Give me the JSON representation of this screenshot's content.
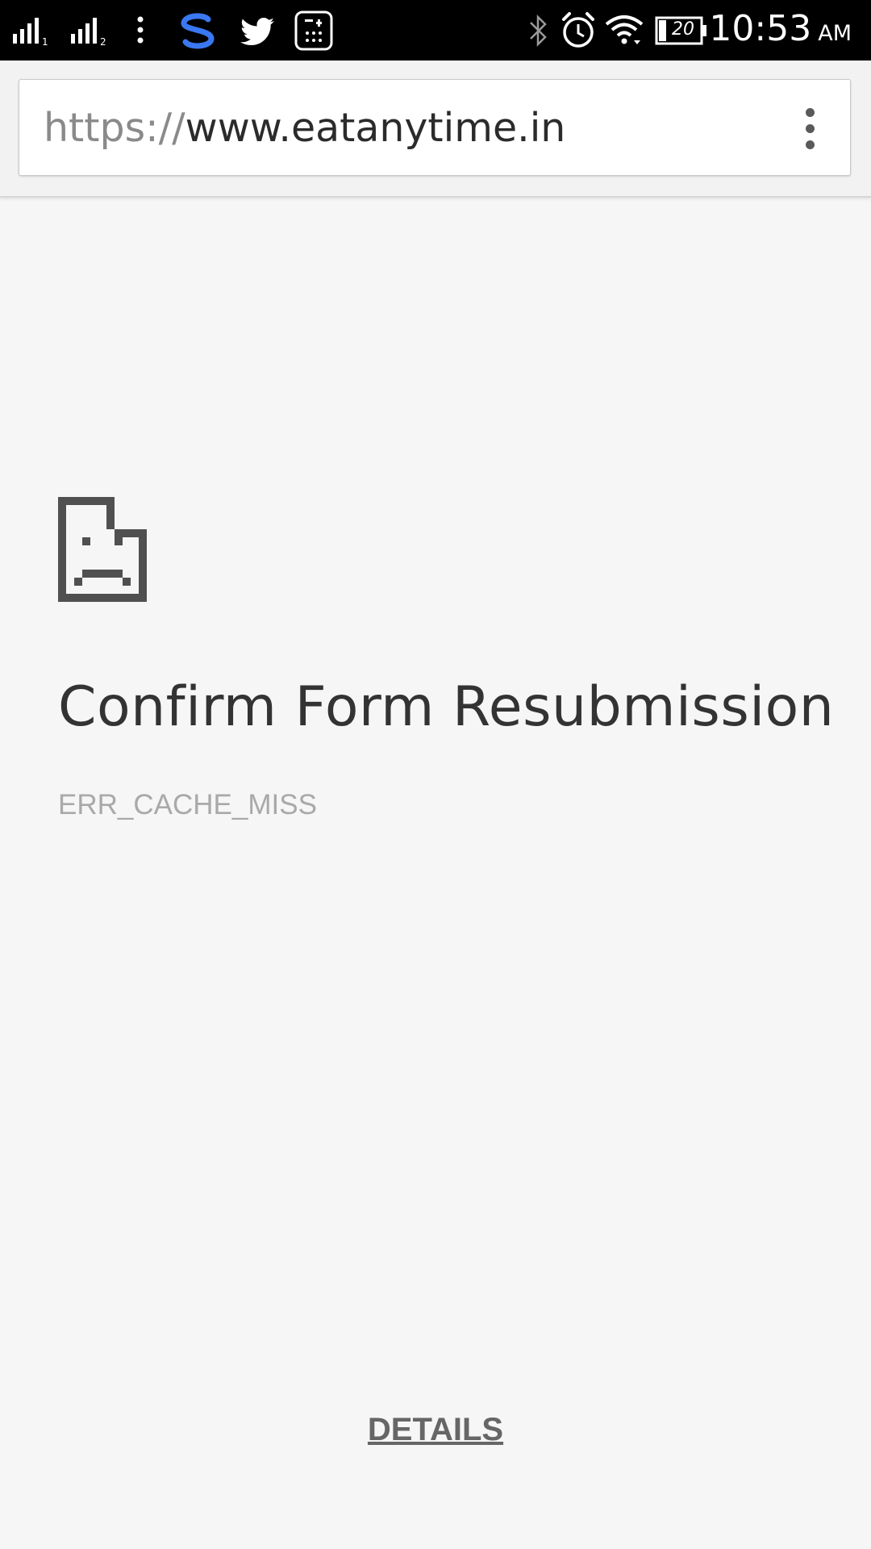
{
  "status_bar": {
    "notification_icons": [
      "signal-sim1-icon",
      "signal-sim2-icon",
      "more-notifications-icon",
      "s-app-icon",
      "twitter-icon",
      "calculator-icon"
    ],
    "system_icons": [
      "bluetooth-icon",
      "alarm-icon",
      "wifi-icon",
      "battery-icon"
    ],
    "battery_level": "20",
    "time": "10:53",
    "ampm": "AM",
    "colors": {
      "background": "#000000",
      "s_app": "#3a78f2"
    }
  },
  "address_bar": {
    "url_scheme": "https://",
    "url_host": "www.eatanytime.in",
    "menu_icon": "more-vert-icon"
  },
  "error_page": {
    "icon": "sad-document-icon",
    "title": "Confirm Form Resubmission",
    "error_code": "ERR_CACHE_MISS",
    "details_label": "DETAILS"
  }
}
